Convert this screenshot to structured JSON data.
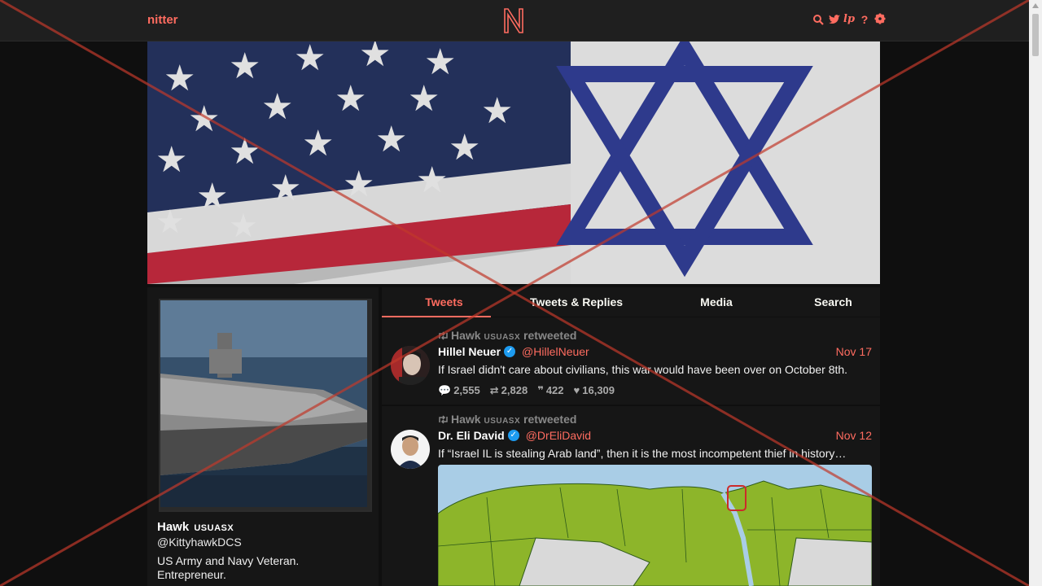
{
  "nav": {
    "brand": "nitter",
    "logo_letter": "N",
    "icons": [
      "search-icon",
      "twitter-bird-icon",
      "rss-lp-icon",
      "help-icon",
      "gear-icon"
    ]
  },
  "profile": {
    "fullname": "Hawk",
    "fullname_suffix": "USUASX",
    "username": "@KittyhawkDCS",
    "bio": "US Army and Navy Veteran. Entrepreneur."
  },
  "tabs": [
    "Tweets",
    "Tweets & Replies",
    "Media",
    "Search"
  ],
  "active_tab": "Tweets",
  "tweets": [
    {
      "retweet_by": "Hawk",
      "retweet_suffix": "USUASX",
      "retweet_label": "retweeted",
      "name": "Hillel Neuer",
      "handle": "@HillelNeuer",
      "date": "Nov 17",
      "text": "If Israel didn't care about civilians, this war would have been over on October 8th.",
      "replies": "2,555",
      "retweets": "2,828",
      "quotes": "422",
      "likes": "16,309"
    },
    {
      "retweet_by": "Hawk",
      "retweet_suffix": "USUASX",
      "retweet_label": "retweeted",
      "name": "Dr. Eli David",
      "handle": "@DrEliDavid",
      "date": "Nov 12",
      "text": "If “Israel ‪‬IL is stealing Arab land”, then it is the most incompetent thief in history…"
    }
  ],
  "colors": {
    "accent": "#ff6c60",
    "background": "#0f0f0f",
    "panel": "#161616",
    "nav": "#1f1f1f",
    "verified": "#1d9bf0",
    "overlay_x": "#c0392b"
  }
}
